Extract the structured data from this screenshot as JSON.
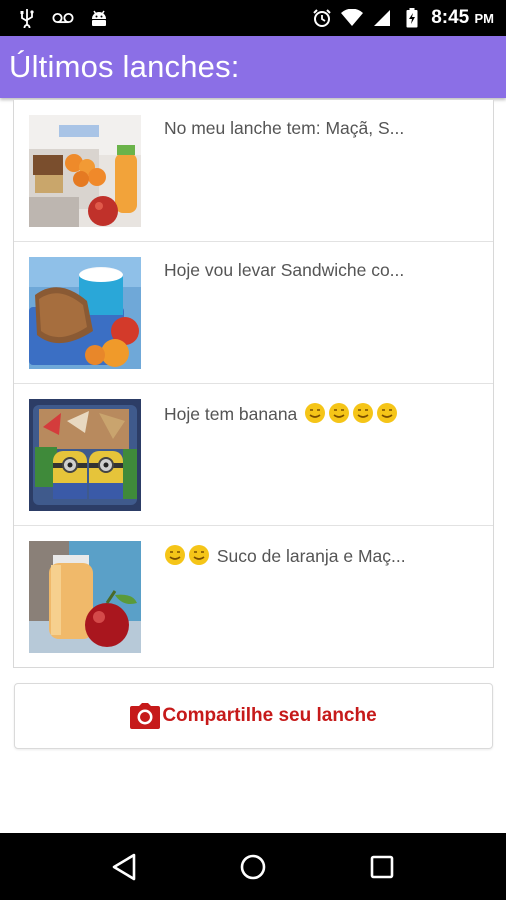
{
  "status_bar": {
    "time": "8:45",
    "ampm": "PM",
    "icons": [
      "usb-icon",
      "voicemail-icon",
      "android-icon",
      "alarm-icon",
      "wifi-icon",
      "signal-icon",
      "battery-charging-icon"
    ]
  },
  "app_bar": {
    "title": "Últimos lanches:",
    "color": "#8b6fe6"
  },
  "feed": {
    "items": [
      {
        "caption": "No meu lanche tem: Maçã, S...",
        "image": "lunchbox-fruit-photo"
      },
      {
        "caption": "Hoje vou levar Sandwiche co...",
        "image": "sandwich-milk-photo"
      },
      {
        "caption": "Hoje tem banana",
        "emoji_count": 4,
        "emoji_position": "after",
        "image": "bento-minions-photo"
      },
      {
        "caption": "Suco de laranja e Maç...",
        "emoji_count": 2,
        "emoji_position": "before",
        "image": "juice-apple-photo"
      }
    ]
  },
  "share_button": {
    "label": "Compartilhe seu lanche",
    "icon": "camera-icon",
    "color": "#c61a1a"
  },
  "nav_bar": {
    "icons": [
      "back-icon",
      "home-icon",
      "recents-icon"
    ]
  }
}
